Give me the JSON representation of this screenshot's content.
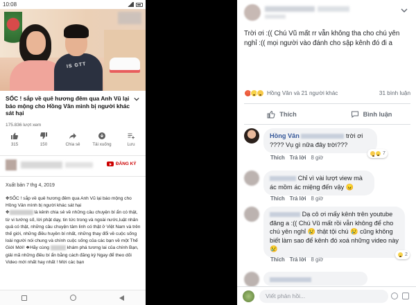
{
  "youtube": {
    "status_time": "10:08",
    "video_shirt_text": "IS GTT",
    "title": "SỐC ! sắp về quê hương  đêm qua Anh Vũ lại báo mộng cho Hồng Vân mình bị người khác sát hại",
    "views": "175.836 lượt xem",
    "actions": [
      {
        "icon": "thumbs-up-icon",
        "label": "315"
      },
      {
        "icon": "thumbs-down-icon",
        "label": "150"
      },
      {
        "icon": "share-icon",
        "label": "Chia sẻ"
      },
      {
        "icon": "download-icon",
        "label": "Tải xuống"
      },
      {
        "icon": "add-to-playlist-icon",
        "label": "Lưu"
      }
    ],
    "subscribe_label": "ĐĂNG KÝ",
    "publish_date": "Xuất bản 7 thg 4, 2019",
    "description": {
      "l1": "✥SỐC ! sắp về quê hương  đêm qua Anh Vũ lại báo mộng cho Hồng Vân mình bị người khác sát hại",
      "l2a": "✥",
      "l2b": "là kênh chia sẻ về những câu chuyện bí ẩn có thật, từ vi tướng số, lời phật dạy, tin tức trong và ngoài nước,luật nhân quả có thật, những câu chuyện tâm linh có thật ở Việt Nam và trên thế giới, những điều huyền bí nhất, những thay đổi về cuộc sống loài người nói chung và chính cuộc sống của các bạn về một Thế Giới Mới! ❖Hãy cùng",
      "l2c": "khám phá tương lai của chính Bạn, giải mã những điều bí ẩn bằng cách đăng ký Ngay để theo dõi Video mới nhất hay nhất ! Mời các bạn"
    }
  },
  "facebook": {
    "post_text": "Trời ơi :(( Chú Vũ mất rr vẫn không tha cho chú yên nghỉ :(( mọi người vào đánh cho sập kênh đó đi a",
    "reactions_names": "Hồng Vân và 21 người khác",
    "shares": "31 bình luận",
    "like_label": "Thích",
    "comment_label": "Bình luận",
    "comments": [
      {
        "name": "Hồng Vân",
        "text_a": "trời ơi",
        "text_b": "???? Vụ gì nữa đây trời???",
        "like": "Thích",
        "reply": "Trả lời",
        "time": "8 giờ",
        "reaction_count": "7"
      },
      {
        "text": "Chỉ vì vài lượt view mà ác mồm ác miệng đến vậy 😠",
        "like": "Thích",
        "reply": "Trả lời",
        "time": "8 giờ"
      },
      {
        "text": "Dạ cô ơi mấy kênh trên youtube đăng a :(( Chú Vũ mất rồi vẫn không để cho chú yên nghỉ 😢 thật tội chú 😢 cũng không biết làm sao để kênh đó xoá những video này 😢",
        "like": "Thích",
        "reply": "Trả lời",
        "time": "8 giờ",
        "reaction_count": "2"
      },
      {
        "text": ""
      }
    ],
    "input_placeholder": "Viết phản hồi..."
  }
}
